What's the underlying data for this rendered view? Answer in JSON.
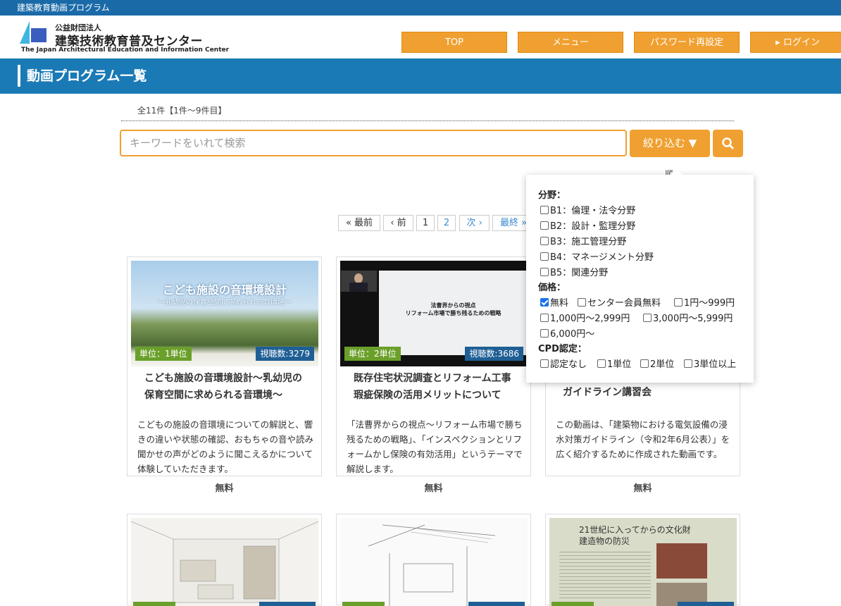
{
  "site_strip": "建築教育動画プログラム",
  "logo": {
    "small": "公益財団法人",
    "large": "建築技術教育普及センター",
    "english": "The Japan Architectural Education and Information Center"
  },
  "nav": [
    {
      "label": "TOP"
    },
    {
      "label": "メニュー"
    },
    {
      "label": "パスワード再設定"
    },
    {
      "label": "ログイン"
    }
  ],
  "page_title": "動画プログラム一覧",
  "result_count": "全11件【1件～9件目】",
  "search": {
    "placeholder": "キーワードをいれて検索",
    "filter_label": "絞り込む ▼"
  },
  "sort_peek": "順 ▲",
  "pagination": {
    "first": "« 最前",
    "prev": "‹ 前",
    "pages": [
      "1",
      "2"
    ],
    "next": "次 ›",
    "last": "最終 »"
  },
  "cards": [
    {
      "unit": "単位：1単位",
      "views": "視聴数:3279",
      "title": "こども施設の音環境設計～乳幼児の保育空間に求められる音環境～",
      "desc": "こどもの施設の音環境についての解説と、響きの違いや状態の確認、おもちゃの音や読み聞かせの声がどのように聞こえるかについて体験していただきます。",
      "price": "無料",
      "thumb_title": "こども施設の音環境設計",
      "thumb_sub": "〜乳幼児の保育空間に求められる音環境〜"
    },
    {
      "unit": "単位：2単位",
      "views": "視聴数:3686",
      "title": "既存住宅状況調査とリフォーム工事瑕疵保険の活用メリットについて",
      "desc": "「法曹界からの視点～リフォーム市場で勝ち残るための戦略」、「インスペクションとリフォームかし保険の有効活用」というテーマで解説します。",
      "price": "無料",
      "thumb_title": "法曹界からの視点",
      "thumb_sub": "リフォーム市場で勝ち残るための戦略"
    },
    {
      "title": "ガイドライン講習会",
      "desc": "この動画は、「建築物における電気設備の浸水対策ガイドライン（令和2年6月公表）」を広く紹介するために作成された動画です。",
      "price": "無料"
    }
  ],
  "row2_third_text": [
    "21世紀に入ってからの文化財",
    "建造物の防災"
  ],
  "filters": {
    "field_label": "分野：",
    "fields": [
      "B1：倫理・法令分野",
      "B2：設計・監理分野",
      "B3：施工管理分野",
      "B4：マネージメント分野",
      "B5：関連分野"
    ],
    "price_label": "価格：",
    "prices": [
      {
        "label": "無料",
        "checked": true
      },
      {
        "label": "センター会員無料"
      },
      {
        "label": "1円～999円"
      },
      {
        "label": "1,000円～2,999円"
      },
      {
        "label": "3,000円～5,999円"
      },
      {
        "label": "6,000円～"
      }
    ],
    "cpd_label": "CPD認定：",
    "cpd": [
      "認定なし",
      "1単位",
      "2単位",
      "3単位以上"
    ]
  },
  "colors": {
    "brand_blue": "#1a7ab5",
    "accent_orange": "#f0a030",
    "unit_green": "#6aa02a",
    "views_navy": "#1f5f95"
  }
}
